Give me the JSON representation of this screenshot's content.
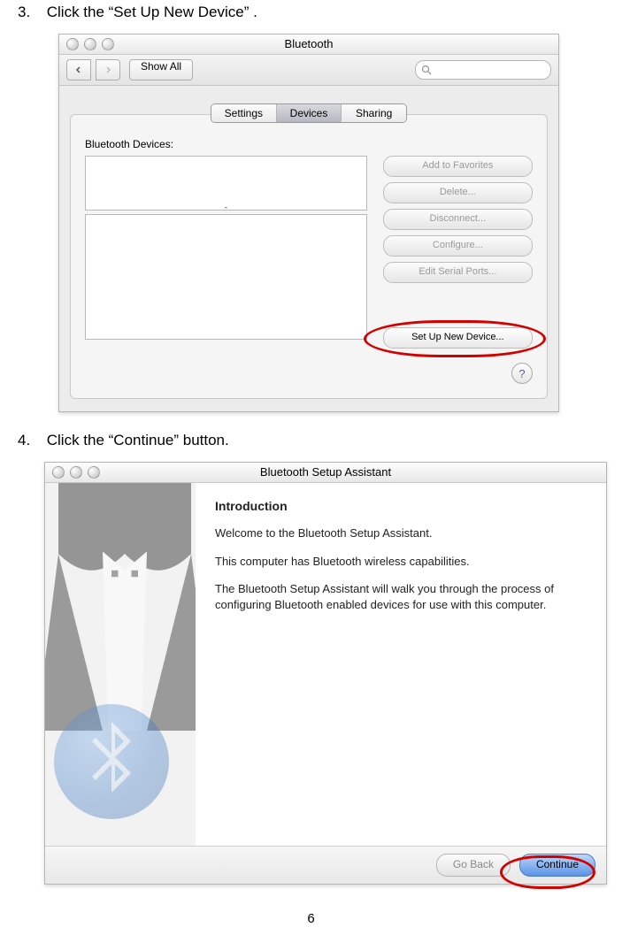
{
  "steps": {
    "three": {
      "num": "3.",
      "text": "Click the “Set Up New Device” ."
    },
    "four": {
      "num": "4.",
      "text": "Click the “Continue” button."
    }
  },
  "bt_window": {
    "title": "Bluetooth",
    "show_all": "Show All",
    "search_placeholder": "",
    "tabs": {
      "settings": "Settings",
      "devices": "Devices",
      "sharing": "Sharing"
    },
    "devices_label": "Bluetooth Devices:",
    "buttons": {
      "fav": "Add to Favorites",
      "del": "Delete...",
      "disc": "Disconnect...",
      "conf": "Configure...",
      "serial": "Edit Serial Ports...",
      "setup": "Set Up New Device..."
    },
    "help": "?"
  },
  "setup_window": {
    "title": "Bluetooth Setup Assistant",
    "heading": "Introduction",
    "p1": "Welcome to the Bluetooth Setup Assistant.",
    "p2": "This computer has Bluetooth wireless capabilities.",
    "p3": "The Bluetooth Setup Assistant will walk you through the process of configuring Bluetooth enabled devices for use with this computer.",
    "go_back": "Go Back",
    "cont": "Continue"
  },
  "page_number": "6"
}
